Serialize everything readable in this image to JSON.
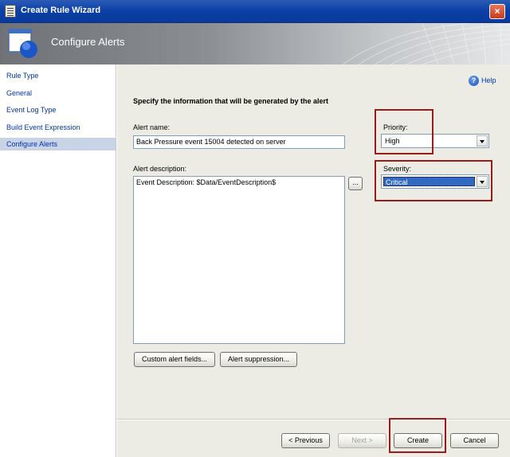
{
  "window": {
    "title": "Create Rule Wizard",
    "close_glyph": "×"
  },
  "banner": {
    "title": "Configure Alerts"
  },
  "nav": {
    "items": [
      {
        "label": "Rule Type"
      },
      {
        "label": "General"
      },
      {
        "label": "Event Log Type"
      },
      {
        "label": "Build Event Expression"
      },
      {
        "label": "Configure Alerts"
      }
    ],
    "active_index": 4
  },
  "help": {
    "icon_glyph": "?",
    "label": "Help"
  },
  "form": {
    "section_title": "Specify the information that will be generated by the alert",
    "alert_name": {
      "label": "Alert name:",
      "value": "Back Pressure event 15004 detected on server"
    },
    "alert_description": {
      "label": "Alert description:",
      "value": "Event Description: $Data/EventDescription$",
      "ellipsis_button": "..."
    },
    "priority": {
      "label": "Priority:",
      "value": "High"
    },
    "severity": {
      "label": "Severity:",
      "value": "Critical"
    },
    "custom_fields_button": "Custom alert fields...",
    "suppression_button": "Alert suppression..."
  },
  "footer": {
    "previous": "< Previous",
    "next": "Next >",
    "create": "Create",
    "cancel": "Cancel"
  },
  "colors": {
    "highlight_box": "#9b1b1b",
    "nav_link": "#0033aa",
    "nav_active_bg": "#c9d3e6",
    "panel_bg": "#ecece4"
  }
}
